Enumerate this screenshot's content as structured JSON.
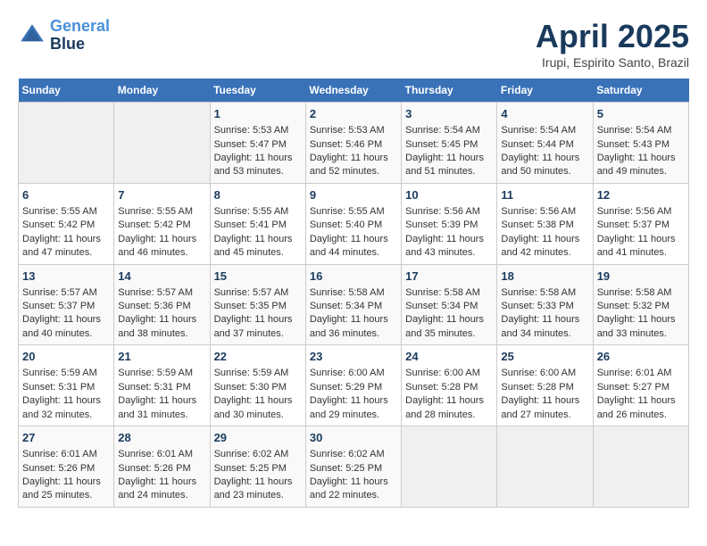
{
  "header": {
    "logo_line1": "General",
    "logo_line2": "Blue",
    "month": "April 2025",
    "location": "Irupi, Espirito Santo, Brazil"
  },
  "weekdays": [
    "Sunday",
    "Monday",
    "Tuesday",
    "Wednesday",
    "Thursday",
    "Friday",
    "Saturday"
  ],
  "weeks": [
    [
      {
        "day": "",
        "info": ""
      },
      {
        "day": "",
        "info": ""
      },
      {
        "day": "1",
        "info": "Sunrise: 5:53 AM\nSunset: 5:47 PM\nDaylight: 11 hours and 53 minutes."
      },
      {
        "day": "2",
        "info": "Sunrise: 5:53 AM\nSunset: 5:46 PM\nDaylight: 11 hours and 52 minutes."
      },
      {
        "day": "3",
        "info": "Sunrise: 5:54 AM\nSunset: 5:45 PM\nDaylight: 11 hours and 51 minutes."
      },
      {
        "day": "4",
        "info": "Sunrise: 5:54 AM\nSunset: 5:44 PM\nDaylight: 11 hours and 50 minutes."
      },
      {
        "day": "5",
        "info": "Sunrise: 5:54 AM\nSunset: 5:43 PM\nDaylight: 11 hours and 49 minutes."
      }
    ],
    [
      {
        "day": "6",
        "info": "Sunrise: 5:55 AM\nSunset: 5:42 PM\nDaylight: 11 hours and 47 minutes."
      },
      {
        "day": "7",
        "info": "Sunrise: 5:55 AM\nSunset: 5:42 PM\nDaylight: 11 hours and 46 minutes."
      },
      {
        "day": "8",
        "info": "Sunrise: 5:55 AM\nSunset: 5:41 PM\nDaylight: 11 hours and 45 minutes."
      },
      {
        "day": "9",
        "info": "Sunrise: 5:55 AM\nSunset: 5:40 PM\nDaylight: 11 hours and 44 minutes."
      },
      {
        "day": "10",
        "info": "Sunrise: 5:56 AM\nSunset: 5:39 PM\nDaylight: 11 hours and 43 minutes."
      },
      {
        "day": "11",
        "info": "Sunrise: 5:56 AM\nSunset: 5:38 PM\nDaylight: 11 hours and 42 minutes."
      },
      {
        "day": "12",
        "info": "Sunrise: 5:56 AM\nSunset: 5:37 PM\nDaylight: 11 hours and 41 minutes."
      }
    ],
    [
      {
        "day": "13",
        "info": "Sunrise: 5:57 AM\nSunset: 5:37 PM\nDaylight: 11 hours and 40 minutes."
      },
      {
        "day": "14",
        "info": "Sunrise: 5:57 AM\nSunset: 5:36 PM\nDaylight: 11 hours and 38 minutes."
      },
      {
        "day": "15",
        "info": "Sunrise: 5:57 AM\nSunset: 5:35 PM\nDaylight: 11 hours and 37 minutes."
      },
      {
        "day": "16",
        "info": "Sunrise: 5:58 AM\nSunset: 5:34 PM\nDaylight: 11 hours and 36 minutes."
      },
      {
        "day": "17",
        "info": "Sunrise: 5:58 AM\nSunset: 5:34 PM\nDaylight: 11 hours and 35 minutes."
      },
      {
        "day": "18",
        "info": "Sunrise: 5:58 AM\nSunset: 5:33 PM\nDaylight: 11 hours and 34 minutes."
      },
      {
        "day": "19",
        "info": "Sunrise: 5:58 AM\nSunset: 5:32 PM\nDaylight: 11 hours and 33 minutes."
      }
    ],
    [
      {
        "day": "20",
        "info": "Sunrise: 5:59 AM\nSunset: 5:31 PM\nDaylight: 11 hours and 32 minutes."
      },
      {
        "day": "21",
        "info": "Sunrise: 5:59 AM\nSunset: 5:31 PM\nDaylight: 11 hours and 31 minutes."
      },
      {
        "day": "22",
        "info": "Sunrise: 5:59 AM\nSunset: 5:30 PM\nDaylight: 11 hours and 30 minutes."
      },
      {
        "day": "23",
        "info": "Sunrise: 6:00 AM\nSunset: 5:29 PM\nDaylight: 11 hours and 29 minutes."
      },
      {
        "day": "24",
        "info": "Sunrise: 6:00 AM\nSunset: 5:28 PM\nDaylight: 11 hours and 28 minutes."
      },
      {
        "day": "25",
        "info": "Sunrise: 6:00 AM\nSunset: 5:28 PM\nDaylight: 11 hours and 27 minutes."
      },
      {
        "day": "26",
        "info": "Sunrise: 6:01 AM\nSunset: 5:27 PM\nDaylight: 11 hours and 26 minutes."
      }
    ],
    [
      {
        "day": "27",
        "info": "Sunrise: 6:01 AM\nSunset: 5:26 PM\nDaylight: 11 hours and 25 minutes."
      },
      {
        "day": "28",
        "info": "Sunrise: 6:01 AM\nSunset: 5:26 PM\nDaylight: 11 hours and 24 minutes."
      },
      {
        "day": "29",
        "info": "Sunrise: 6:02 AM\nSunset: 5:25 PM\nDaylight: 11 hours and 23 minutes."
      },
      {
        "day": "30",
        "info": "Sunrise: 6:02 AM\nSunset: 5:25 PM\nDaylight: 11 hours and 22 minutes."
      },
      {
        "day": "",
        "info": ""
      },
      {
        "day": "",
        "info": ""
      },
      {
        "day": "",
        "info": ""
      }
    ]
  ]
}
